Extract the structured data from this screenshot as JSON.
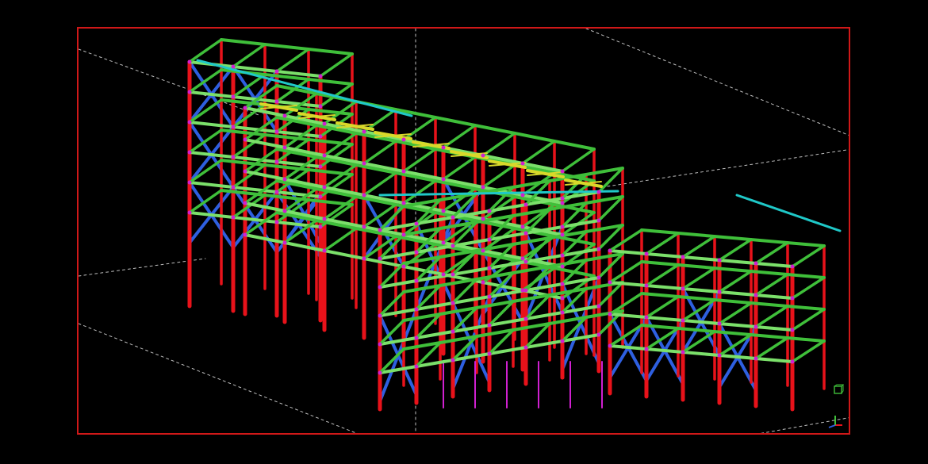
{
  "app": {
    "view_mode": "3D model view",
    "viewport_border_color": "#d01818",
    "background_color": "#000000"
  },
  "colors": {
    "column": "#e8121a",
    "beam": "#3fbf3a",
    "beam_highlight": "#7be06a",
    "bracing": "#2e5fe0",
    "truss": "#d8d82a",
    "cyan": "#1fc8c8",
    "connection": "#d020d0",
    "grid": "#bfbfbf"
  },
  "icons": {
    "view_cube": "view-cube-icon",
    "axis_gizmo": "axis-gizmo-icon"
  }
}
